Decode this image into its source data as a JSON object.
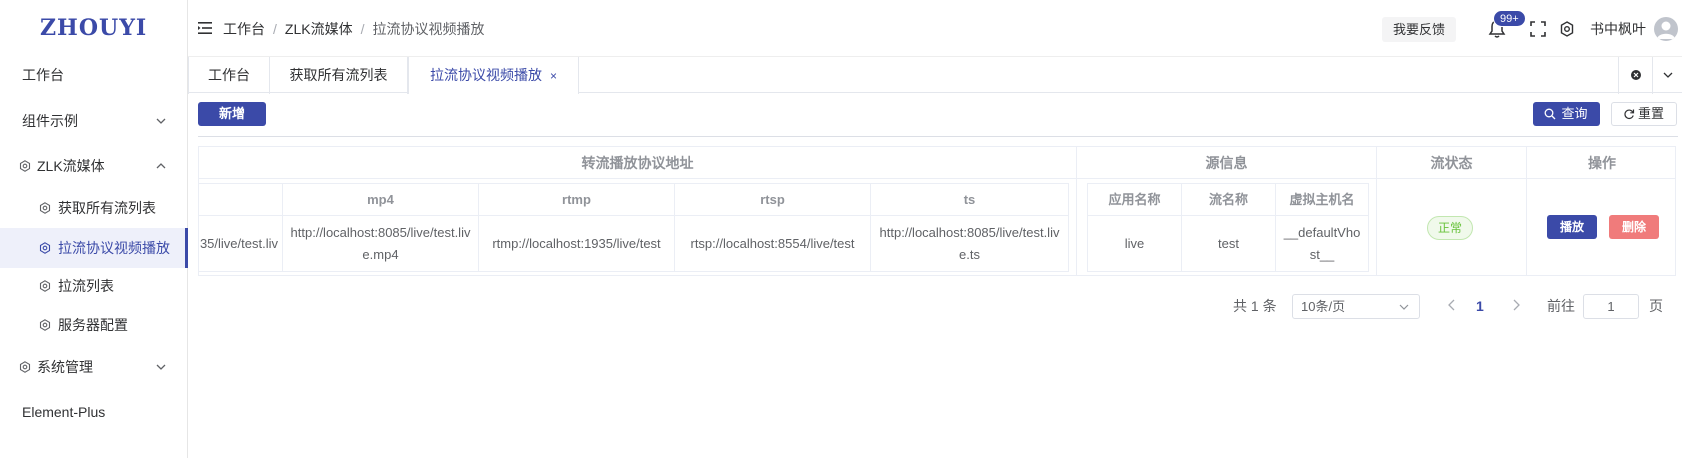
{
  "app": {
    "logo": "ZHOUYI"
  },
  "sidebar": {
    "items": [
      {
        "label": "工作台"
      },
      {
        "label": "组件示例"
      },
      {
        "label": "ZLK流媒体"
      },
      {
        "label": "获取所有流列表"
      },
      {
        "label": "拉流协议视频播放"
      },
      {
        "label": "拉流列表"
      },
      {
        "label": "服务器配置"
      },
      {
        "label": "系统管理"
      },
      {
        "label": "Element-Plus"
      }
    ],
    "active_index": 4
  },
  "header": {
    "breadcrumb": [
      "工作台",
      "ZLK流媒体",
      "拉流协议视频播放"
    ],
    "breadcrumb_sep": "/",
    "feedback": "我要反馈",
    "badge": "99+",
    "username": "书中枫叶"
  },
  "tabs": [
    {
      "label": "工作台"
    },
    {
      "label": "获取所有流列表"
    },
    {
      "label": "拉流协议视频播放",
      "close": "×"
    }
  ],
  "toolbar": {
    "add": "新增",
    "search": "查询",
    "reset": "重置"
  },
  "table": {
    "group_headers": {
      "protocols": "转流播放协议地址",
      "source": "源信息",
      "status": "流状态",
      "actions": "操作"
    },
    "protocol_cols": [
      "mp4",
      "rtmp",
      "rtsp",
      "ts"
    ],
    "source_cols": [
      "应用名称",
      "流名称",
      "虚拟主机名"
    ],
    "row": {
      "partial": "35/live/test.liv",
      "mp4": "http://localhost:8085/live/test.live.mp4",
      "rtmp": "rtmp://localhost:1935/live/test",
      "rtsp": "rtsp://localhost:8554/live/test",
      "ts": "http://localhost:8085/live/test.live.ts",
      "app": "live",
      "stream": "test",
      "vhost": "__defaultVhost__",
      "status": "正常",
      "play": "播放",
      "delete": "删除"
    }
  },
  "pagination": {
    "total": "共 1 条",
    "page_size": "10条/页",
    "current": "1",
    "goto_label": "前往",
    "goto_value": "1",
    "page_suffix": "页"
  },
  "colors": {
    "primary": "#3b4aa8",
    "danger": "#f07b7b",
    "success": "#67c23a"
  }
}
